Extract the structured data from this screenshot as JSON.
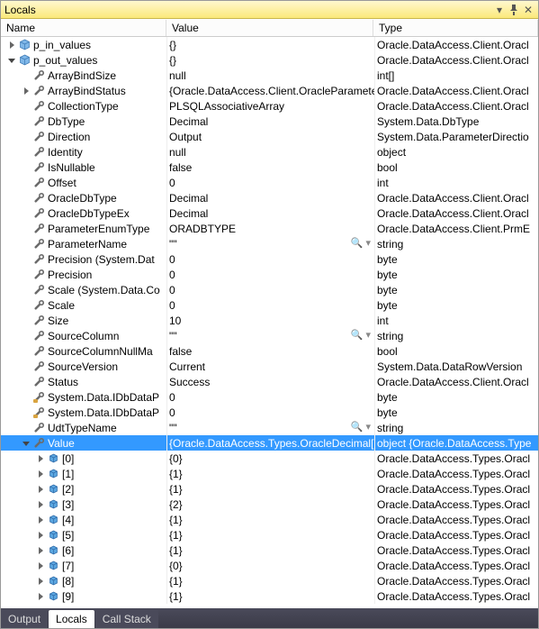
{
  "window": {
    "title": "Locals"
  },
  "titlebar_buttons": {
    "dropdown": "▾",
    "pin": "📌",
    "close": "✕"
  },
  "header": {
    "name": "Name",
    "value": "Value",
    "type": "Type"
  },
  "icons": {
    "cube_blue": "cube-blue",
    "wrench": "wrench",
    "array_box": "array-box"
  },
  "rows": [
    {
      "depth": 0,
      "expander": "closed",
      "icon": "cube",
      "name": "p_in_values",
      "value": "{}",
      "type": "Oracle.DataAccess.Client.Oracl",
      "hasMag": false
    },
    {
      "depth": 0,
      "expander": "open",
      "icon": "cube",
      "name": "p_out_values",
      "value": "{}",
      "type": "Oracle.DataAccess.Client.Oracl",
      "hasMag": false
    },
    {
      "depth": 1,
      "expander": "",
      "icon": "wrench",
      "name": "ArrayBindSize",
      "value": "null",
      "type": "int[]",
      "hasMag": false
    },
    {
      "depth": 1,
      "expander": "closed",
      "icon": "wrench",
      "name": "ArrayBindStatus",
      "value": "{Oracle.DataAccess.Client.OracleParamete",
      "type": "Oracle.DataAccess.Client.Oracl",
      "hasMag": false
    },
    {
      "depth": 1,
      "expander": "",
      "icon": "wrench",
      "name": "CollectionType",
      "value": "PLSQLAssociativeArray",
      "type": "Oracle.DataAccess.Client.Oracl",
      "hasMag": false
    },
    {
      "depth": 1,
      "expander": "",
      "icon": "wrench",
      "name": "DbType",
      "value": "Decimal",
      "type": "System.Data.DbType",
      "hasMag": false
    },
    {
      "depth": 1,
      "expander": "",
      "icon": "wrench",
      "name": "Direction",
      "value": "Output",
      "type": "System.Data.ParameterDirectio",
      "hasMag": false
    },
    {
      "depth": 1,
      "expander": "",
      "icon": "wrench",
      "name": "Identity",
      "value": "null",
      "type": "object",
      "hasMag": false
    },
    {
      "depth": 1,
      "expander": "",
      "icon": "wrench",
      "name": "IsNullable",
      "value": "false",
      "type": "bool",
      "hasMag": false
    },
    {
      "depth": 1,
      "expander": "",
      "icon": "wrench",
      "name": "Offset",
      "value": "0",
      "type": "int",
      "hasMag": false
    },
    {
      "depth": 1,
      "expander": "",
      "icon": "wrench",
      "name": "OracleDbType",
      "value": "Decimal",
      "type": "Oracle.DataAccess.Client.Oracl",
      "hasMag": false
    },
    {
      "depth": 1,
      "expander": "",
      "icon": "wrench",
      "name": "OracleDbTypeEx",
      "value": "Decimal",
      "type": "Oracle.DataAccess.Client.Oracl",
      "hasMag": false
    },
    {
      "depth": 1,
      "expander": "",
      "icon": "wrench",
      "name": "ParameterEnumType",
      "value": "ORADBTYPE",
      "type": "Oracle.DataAccess.Client.PrmE",
      "hasMag": false
    },
    {
      "depth": 1,
      "expander": "",
      "icon": "wrench",
      "name": "ParameterName",
      "value": "\"\"",
      "type": "string",
      "hasMag": true
    },
    {
      "depth": 1,
      "expander": "",
      "icon": "wrench",
      "name": "Precision (System.Dat",
      "value": "0",
      "type": "byte",
      "hasMag": false
    },
    {
      "depth": 1,
      "expander": "",
      "icon": "wrench",
      "name": "Precision",
      "value": "0",
      "type": "byte",
      "hasMag": false
    },
    {
      "depth": 1,
      "expander": "",
      "icon": "wrench",
      "name": "Scale (System.Data.Co",
      "value": "0",
      "type": "byte",
      "hasMag": false
    },
    {
      "depth": 1,
      "expander": "",
      "icon": "wrench",
      "name": "Scale",
      "value": "0",
      "type": "byte",
      "hasMag": false
    },
    {
      "depth": 1,
      "expander": "",
      "icon": "wrench",
      "name": "Size",
      "value": "10",
      "type": "int",
      "hasMag": false
    },
    {
      "depth": 1,
      "expander": "",
      "icon": "wrench",
      "name": "SourceColumn",
      "value": "\"\"",
      "type": "string",
      "hasMag": true
    },
    {
      "depth": 1,
      "expander": "",
      "icon": "wrench",
      "name": "SourceColumnNullMa",
      "value": "false",
      "type": "bool",
      "hasMag": false
    },
    {
      "depth": 1,
      "expander": "",
      "icon": "wrench",
      "name": "SourceVersion",
      "value": "Current",
      "type": "System.Data.DataRowVersion",
      "hasMag": false
    },
    {
      "depth": 1,
      "expander": "",
      "icon": "wrench",
      "name": "Status",
      "value": "Success",
      "type": "Oracle.DataAccess.Client.Oracl",
      "hasMag": false
    },
    {
      "depth": 1,
      "expander": "",
      "icon": "wrench2",
      "name": "System.Data.IDbDataP",
      "value": "0",
      "type": "byte",
      "hasMag": false
    },
    {
      "depth": 1,
      "expander": "",
      "icon": "wrench2",
      "name": "System.Data.IDbDataP",
      "value": "0",
      "type": "byte",
      "hasMag": false
    },
    {
      "depth": 1,
      "expander": "",
      "icon": "wrench",
      "name": "UdtTypeName",
      "value": "\"\"",
      "type": "string",
      "hasMag": true
    },
    {
      "depth": 1,
      "expander": "open",
      "icon": "wrench",
      "name": "Value",
      "value": "{Oracle.DataAccess.Types.OracleDecimal[1",
      "type": "object {Oracle.DataAccess.Type",
      "hasMag": false,
      "selected": true
    },
    {
      "depth": 2,
      "expander": "closed",
      "icon": "box",
      "name": "[0]",
      "value": "{0}",
      "type": "Oracle.DataAccess.Types.Oracl",
      "hasMag": false
    },
    {
      "depth": 2,
      "expander": "closed",
      "icon": "box",
      "name": "[1]",
      "value": "{1}",
      "type": "Oracle.DataAccess.Types.Oracl",
      "hasMag": false
    },
    {
      "depth": 2,
      "expander": "closed",
      "icon": "box",
      "name": "[2]",
      "value": "{1}",
      "type": "Oracle.DataAccess.Types.Oracl",
      "hasMag": false
    },
    {
      "depth": 2,
      "expander": "closed",
      "icon": "box",
      "name": "[3]",
      "value": "{2}",
      "type": "Oracle.DataAccess.Types.Oracl",
      "hasMag": false
    },
    {
      "depth": 2,
      "expander": "closed",
      "icon": "box",
      "name": "[4]",
      "value": "{1}",
      "type": "Oracle.DataAccess.Types.Oracl",
      "hasMag": false
    },
    {
      "depth": 2,
      "expander": "closed",
      "icon": "box",
      "name": "[5]",
      "value": "{1}",
      "type": "Oracle.DataAccess.Types.Oracl",
      "hasMag": false
    },
    {
      "depth": 2,
      "expander": "closed",
      "icon": "box",
      "name": "[6]",
      "value": "{1}",
      "type": "Oracle.DataAccess.Types.Oracl",
      "hasMag": false
    },
    {
      "depth": 2,
      "expander": "closed",
      "icon": "box",
      "name": "[7]",
      "value": "{0}",
      "type": "Oracle.DataAccess.Types.Oracl",
      "hasMag": false
    },
    {
      "depth": 2,
      "expander": "closed",
      "icon": "box",
      "name": "[8]",
      "value": "{1}",
      "type": "Oracle.DataAccess.Types.Oracl",
      "hasMag": false
    },
    {
      "depth": 2,
      "expander": "closed",
      "icon": "box",
      "name": "[9]",
      "value": "{1}",
      "type": "Oracle.DataAccess.Types.Oracl",
      "hasMag": false
    }
  ],
  "tabs": [
    {
      "label": "Output",
      "active": false
    },
    {
      "label": "Locals",
      "active": true
    },
    {
      "label": "Call Stack",
      "active": false
    }
  ]
}
